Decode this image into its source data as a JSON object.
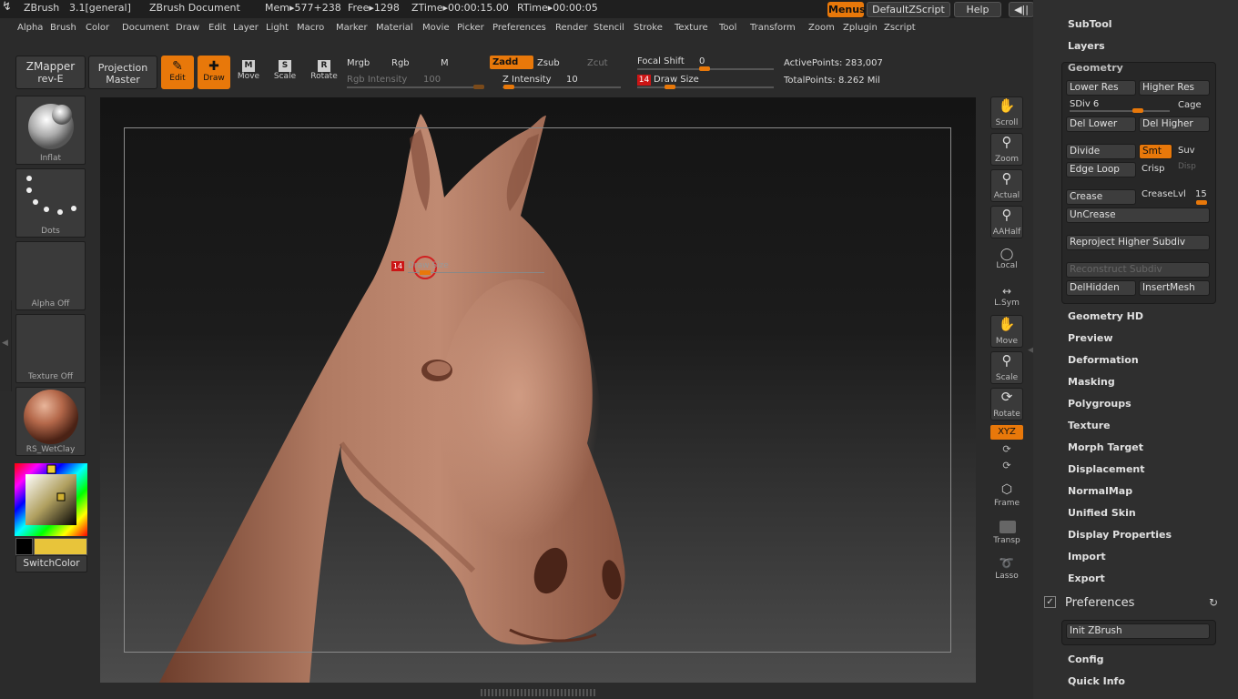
{
  "titlebar": {
    "app": "ZBrush",
    "version": "3.1[general]",
    "document": "ZBrush Document",
    "mem": "Mem▸577+238",
    "free": "Free▸1298",
    "ztime": "ZTime▸00:00:15.00",
    "rtime": "RTime▸00:00:05",
    "menus_label": "Menus",
    "script_label": "DefaultZScript",
    "help_label": "Help"
  },
  "menubar": [
    "Alpha",
    "Brush",
    "Color",
    "Document",
    "Draw",
    "Edit",
    "Layer",
    "Light",
    "Macro",
    "Marker",
    "Material",
    "Movie",
    "Picker",
    "Preferences",
    "Render",
    "Stencil",
    "Stroke",
    "Texture",
    "Tool",
    "Transform",
    "Zoom",
    "Zplugin",
    "Zscript"
  ],
  "shelf": {
    "zmapper_line1": "ZMapper",
    "zmapper_line2": "rev-E",
    "projection_line1": "Projection",
    "projection_line2": "Master",
    "edit_label": "Edit",
    "draw_label": "Draw",
    "move_label": "Move",
    "scale_label": "Scale",
    "rotate_label": "Rotate",
    "mrgb": "Mrgb",
    "rgb": "Rgb",
    "m": "M",
    "rgb_intensity": "Rgb  Intensity",
    "rgb_intensity_value": "100",
    "zadd": "Zadd",
    "zsub": "Zsub",
    "zcut": "Zcut",
    "z_intensity": "Z  Intensity",
    "z_intensity_value": "10",
    "focal_shift": "Focal  Shift",
    "focal_shift_value": "0",
    "draw_size": "Draw  Size",
    "draw_size_value": "14",
    "active_points": "ActivePoints: 283,007",
    "total_points": "TotalPoints: 8.262  Mil",
    "icon_letters": {
      "move": "M",
      "scale": "S",
      "rotate": "R"
    }
  },
  "left_shelf": {
    "inflat": "Inflat",
    "dots": "Dots",
    "alpha": "Alpha  Off",
    "texture": "Texture  Off",
    "material": "RS_WetClay",
    "switchcolor": "SwitchColor",
    "main_color": "#e8c43a"
  },
  "viewport": {
    "cursor_size": "14",
    "cursor_label": "Draw Size"
  },
  "right_shelf": [
    "Scroll",
    "Zoom",
    "Actual",
    "AAHalf",
    "Local",
    "L.Sym",
    "Move",
    "Scale",
    "Rotate",
    "XYZ",
    "Frame",
    "Transp",
    "Lasso"
  ],
  "tray": {
    "subtool": "SubTool",
    "layers": "Layers",
    "geometry_title": "Geometry",
    "lower_res": "Lower Res",
    "higher_res": "Higher Res",
    "sdiv": "SDiv 6",
    "cage": "Cage",
    "del_lower": "Del Lower",
    "del_higher": "Del Higher",
    "divide": "Divide",
    "smt": "Smt",
    "suv": "Suv",
    "edge_loop": "Edge Loop",
    "crisp": "Crisp",
    "disp": "Disp",
    "crease": "Crease",
    "creaselvl": "CreaseLvl",
    "creaselvl_value": "15",
    "uncrease": "UnCrease",
    "reproject": "Reproject Higher Subdiv",
    "reconstruct": "Reconstruct Subdiv",
    "delhidden": "DelHidden",
    "insertmesh": "InsertMesh",
    "items": [
      "Geometry HD",
      "Preview",
      "Deformation",
      "Masking",
      "Polygroups",
      "Texture",
      "Morph Target",
      "Displacement",
      "NormalMap",
      "Unified Skin",
      "Display Properties",
      "Import",
      "Export"
    ],
    "preferences": "Preferences",
    "init_zbrush": "Init ZBrush",
    "config": "Config",
    "quick_info": "Quick Info"
  },
  "colors": {
    "accent": "#e8780a",
    "clay": "#b87b62"
  }
}
